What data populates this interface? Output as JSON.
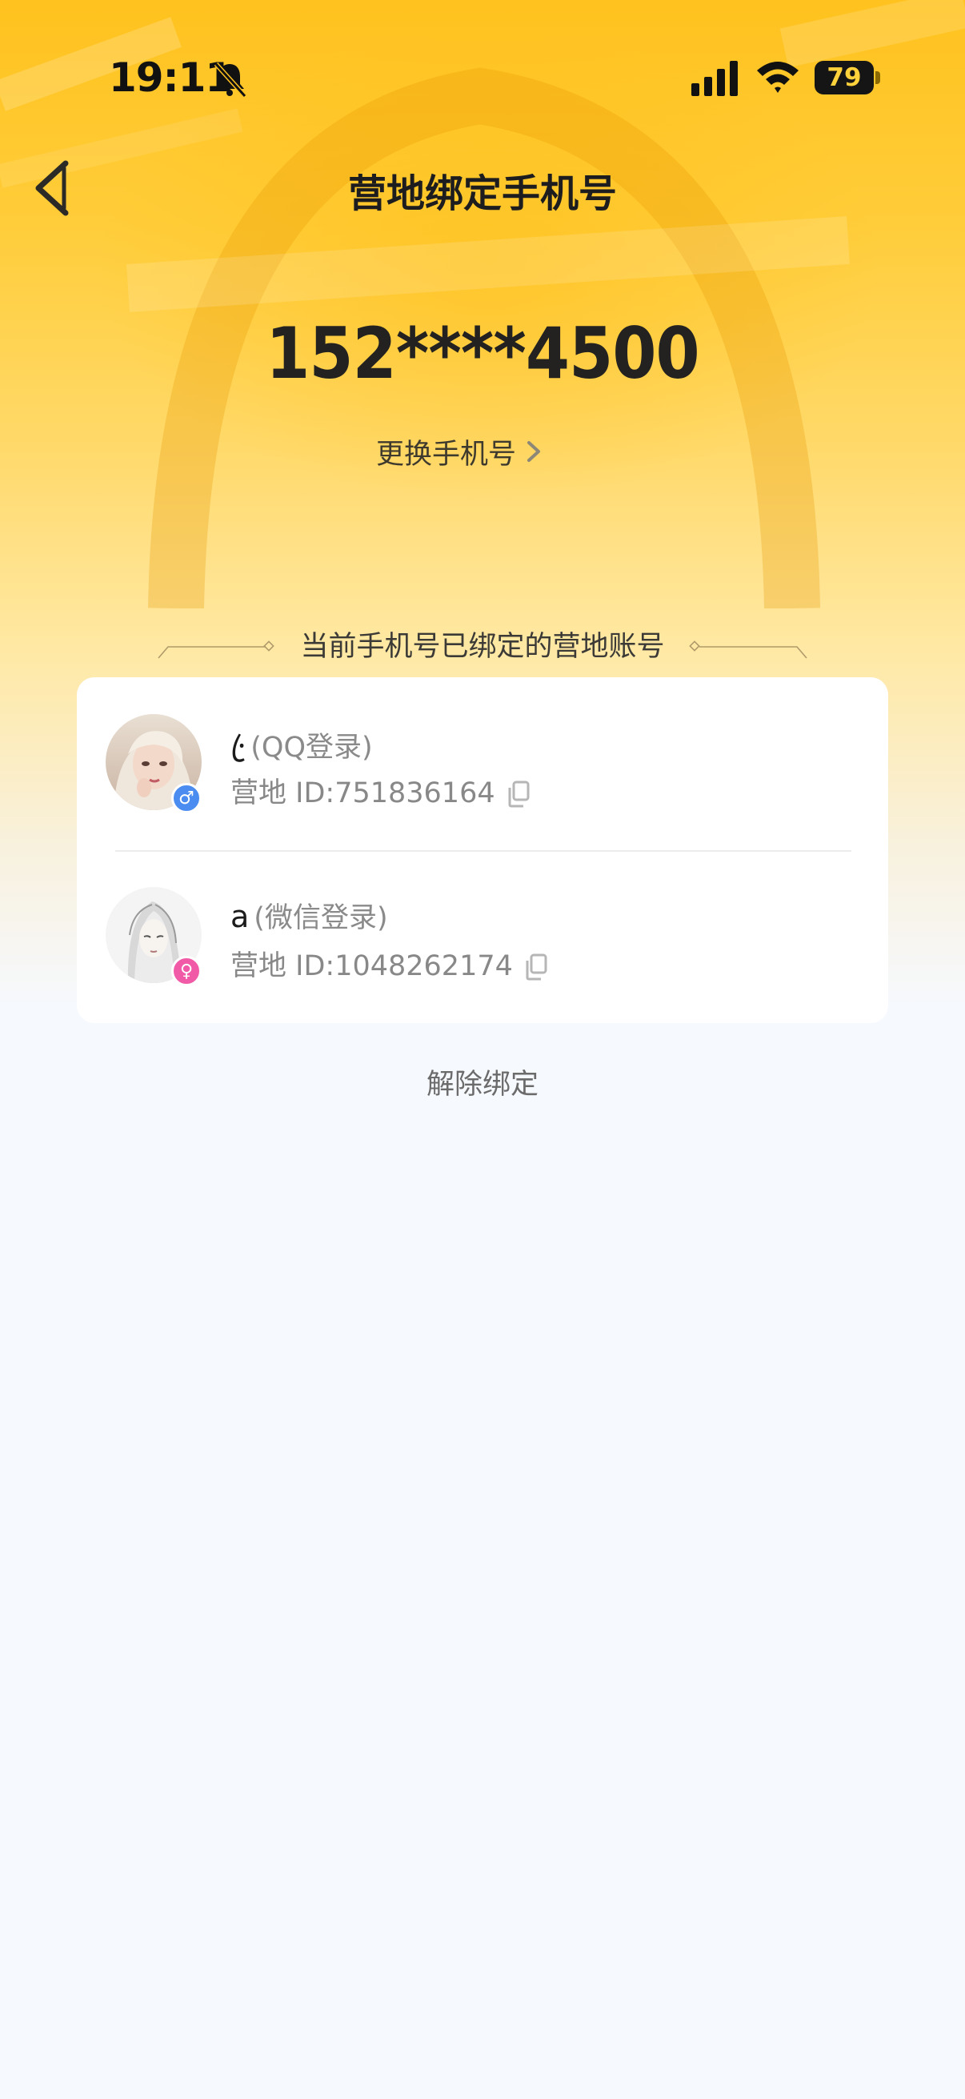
{
  "status_bar": {
    "time": "19:11",
    "battery": "79",
    "icons": [
      "bell-slash-icon",
      "signal-icon",
      "wifi-icon",
      "battery-icon"
    ]
  },
  "nav": {
    "title": "营地绑定手机号",
    "back_icon": "chevron-left-icon"
  },
  "phone": {
    "number": "152****4500",
    "change_label": "更换手机号"
  },
  "section": {
    "title": "当前手机号已绑定的营地账号"
  },
  "accounts": [
    {
      "name": "·ꦿ",
      "login_type": "(QQ登录)",
      "id_text": "营地 ID:751836164",
      "gender": "male",
      "gender_symbol": "♂",
      "badge_color": "#4a8cf0"
    },
    {
      "name": "a",
      "login_type": "(微信登录)",
      "id_text": "营地 ID:1048262174",
      "gender": "female",
      "gender_symbol": "♀",
      "badge_color": "#f05aa6"
    }
  ],
  "actions": {
    "unbind_label": "解除绑定"
  },
  "colors": {
    "hero_top": "#ffc21e",
    "page_bg": "#f6f9fe",
    "card_bg": "#ffffff"
  }
}
